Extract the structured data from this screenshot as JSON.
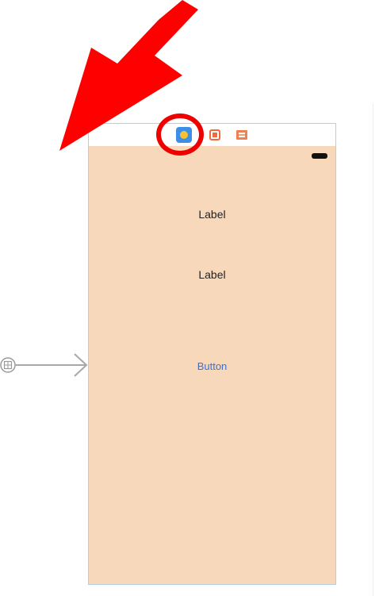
{
  "scene": {
    "dock": {
      "icons": [
        "view-controller-icon",
        "first-responder-icon",
        "exit-icon"
      ]
    },
    "labels": [
      "Label",
      "Label"
    ],
    "button_label": "Button",
    "background_color": "#f8d8bb"
  },
  "annotation": {
    "arrow_color": "#ff0000",
    "highlight_color": "#ee0000"
  }
}
